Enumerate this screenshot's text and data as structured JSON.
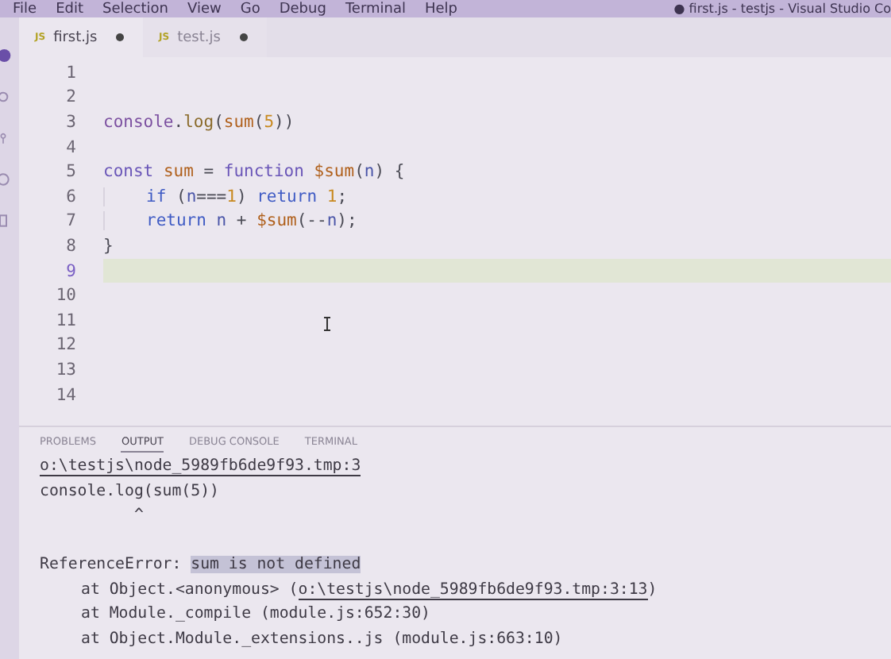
{
  "menu_bar": {
    "items": [
      "File",
      "Edit",
      "Selection",
      "View",
      "Go",
      "Debug",
      "Terminal",
      "Help"
    ],
    "title": "● first.js - testjs - Visual Studio Co"
  },
  "tabs": [
    {
      "label": "first.js",
      "badge": "JS",
      "selected": true,
      "dirty": true
    },
    {
      "label": "test.js",
      "badge": "JS",
      "selected": false,
      "dirty": true
    }
  ],
  "editor": {
    "lines": [
      {
        "number": "1",
        "current": false
      },
      {
        "number": "2",
        "current": false
      },
      {
        "number": "3",
        "current": false,
        "indent": false,
        "tokens": [
          {
            "text": "console",
            "kind": "object"
          },
          {
            "text": ".",
            "kind": "plain"
          },
          {
            "text": "log",
            "kind": "func"
          },
          {
            "text": "(",
            "kind": "plain"
          },
          {
            "text": "sum",
            "kind": "ident"
          },
          {
            "text": "(",
            "kind": "plain"
          },
          {
            "text": "5",
            "kind": "number"
          },
          {
            "text": "))",
            "kind": "plain"
          }
        ]
      },
      {
        "number": "4",
        "current": false
      },
      {
        "number": "5",
        "current": false,
        "indent": false,
        "tokens": [
          {
            "text": "const ",
            "kind": "keyword"
          },
          {
            "text": "sum",
            "kind": "ident"
          },
          {
            "text": " = ",
            "kind": "plain"
          },
          {
            "text": "function ",
            "kind": "keyword"
          },
          {
            "text": "$sum",
            "kind": "ident"
          },
          {
            "text": "(",
            "kind": "plain"
          },
          {
            "text": "n",
            "kind": "param"
          },
          {
            "text": ") {",
            "kind": "plain"
          }
        ]
      },
      {
        "number": "6",
        "current": false,
        "indent": true,
        "tokens": [
          {
            "text": "if",
            "kind": "control"
          },
          {
            "text": " (",
            "kind": "plain"
          },
          {
            "text": "n",
            "kind": "param"
          },
          {
            "text": "===",
            "kind": "plain"
          },
          {
            "text": "1",
            "kind": "number"
          },
          {
            "text": ") ",
            "kind": "plain"
          },
          {
            "text": "return ",
            "kind": "control"
          },
          {
            "text": "1",
            "kind": "number"
          },
          {
            "text": ";",
            "kind": "plain"
          }
        ]
      },
      {
        "number": "7",
        "current": false,
        "indent": true,
        "tokens": [
          {
            "text": "return ",
            "kind": "control"
          },
          {
            "text": "n",
            "kind": "param"
          },
          {
            "text": " + ",
            "kind": "plain"
          },
          {
            "text": "$sum",
            "kind": "ident"
          },
          {
            "text": "(--",
            "kind": "plain"
          },
          {
            "text": "n",
            "kind": "param"
          },
          {
            "text": ");",
            "kind": "plain"
          }
        ]
      },
      {
        "number": "8",
        "current": false,
        "indent": false,
        "tokens": [
          {
            "text": "}",
            "kind": "plain"
          }
        ]
      },
      {
        "number": "9",
        "current": true
      },
      {
        "number": "10",
        "current": false
      },
      {
        "number": "11",
        "current": false
      },
      {
        "number": "12",
        "current": false
      },
      {
        "number": "13",
        "current": false
      },
      {
        "number": "14",
        "current": false
      }
    ]
  },
  "panel": {
    "tabs": [
      {
        "label": "PROBLEMS",
        "selected": false
      },
      {
        "label": "OUTPUT",
        "selected": true
      },
      {
        "label": "DEBUG CONSOLE",
        "selected": false
      },
      {
        "label": "TERMINAL",
        "selected": false
      }
    ],
    "output": [
      {
        "indent": false,
        "segments": [
          {
            "text": "o:\\testjs\\node_5989fb6de9f93.tmp:3",
            "kind": "link"
          }
        ]
      },
      {
        "indent": false,
        "segments": [
          {
            "text": "console.log(sum(5))",
            "kind": "plain"
          }
        ]
      },
      {
        "indent": false,
        "blank_after": true,
        "segments": [
          {
            "text": "          ^",
            "kind": "plain"
          }
        ]
      },
      {
        "indent": false,
        "segments": [
          {
            "text": "ReferenceError: ",
            "kind": "plain"
          },
          {
            "text": "sum is not defined",
            "kind": "selected"
          }
        ]
      },
      {
        "indent": true,
        "segments": [
          {
            "text": "at Object.<anonymous> (",
            "kind": "plain"
          },
          {
            "text": "o:\\testjs\\node_5989fb6de9f93.tmp:3:13",
            "kind": "link"
          },
          {
            "text": ")",
            "kind": "plain"
          }
        ]
      },
      {
        "indent": true,
        "segments": [
          {
            "text": "at Module._compile (module.js:652:30)",
            "kind": "plain"
          }
        ]
      },
      {
        "indent": true,
        "segments": [
          {
            "text": "at Object.Module._extensions..js (module.js:663:10)",
            "kind": "plain"
          }
        ]
      }
    ]
  }
}
